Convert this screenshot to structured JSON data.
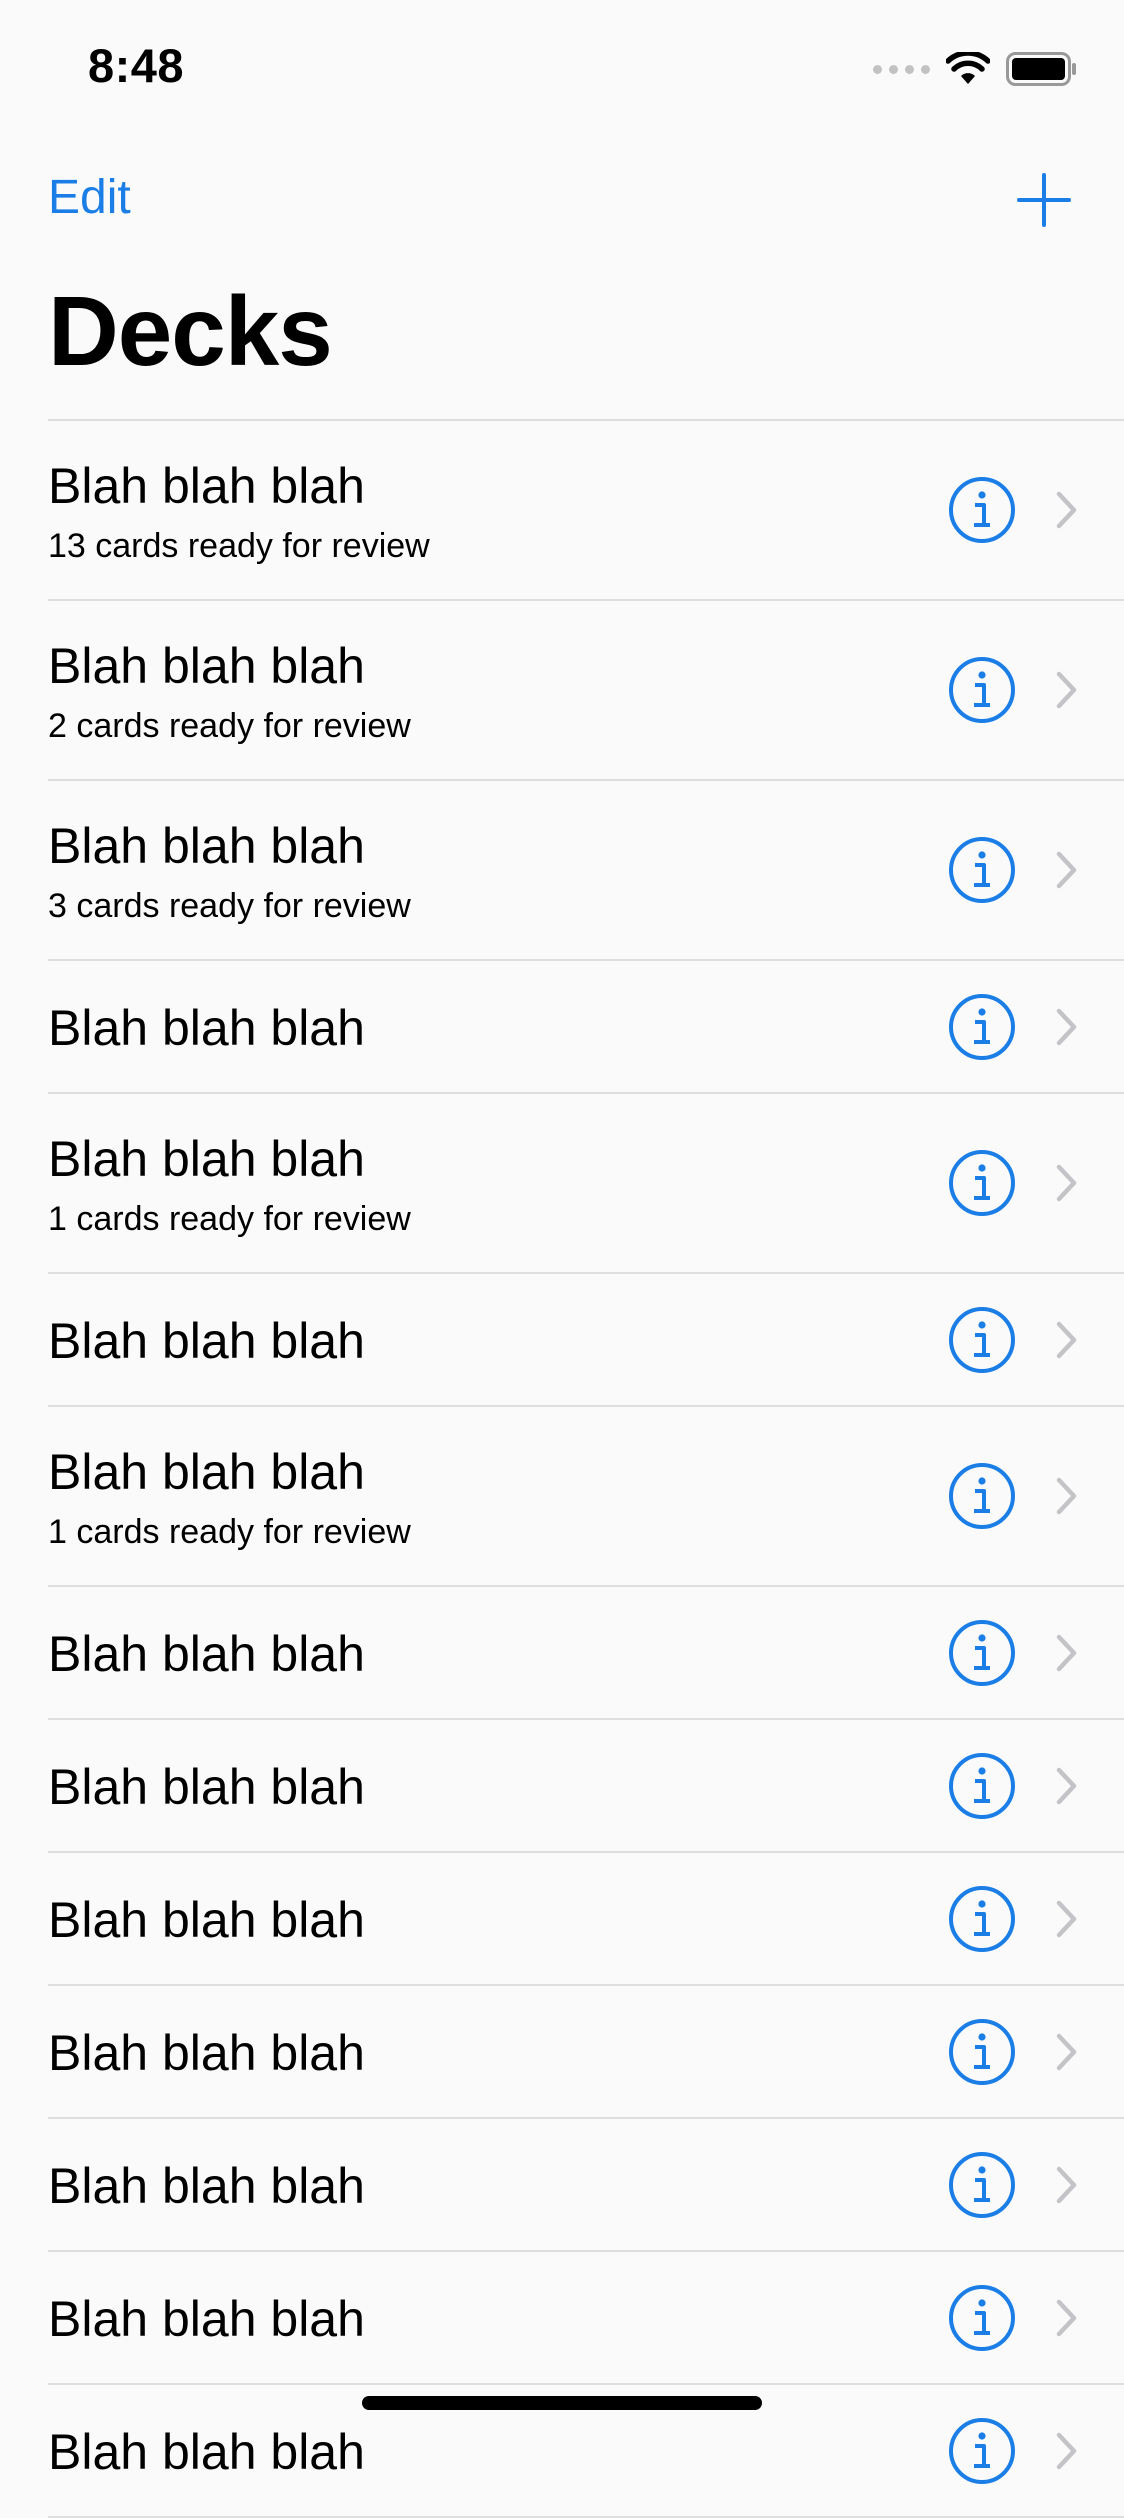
{
  "status_bar": {
    "time": "8:48"
  },
  "nav": {
    "edit_label": "Edit",
    "add_icon": "plus-icon"
  },
  "title": "Decks",
  "colors": {
    "accent": "#1a7ee6",
    "separator": "#dedede",
    "chevron": "#c4c4c8",
    "background": "#fafafa"
  },
  "decks": [
    {
      "title": "Blah blah blah",
      "subtitle": "13 cards ready for review"
    },
    {
      "title": "Blah blah blah",
      "subtitle": "2 cards ready for review"
    },
    {
      "title": "Blah blah blah",
      "subtitle": "3 cards ready for review"
    },
    {
      "title": "Blah blah blah",
      "subtitle": ""
    },
    {
      "title": "Blah blah blah",
      "subtitle": "1 cards ready for review"
    },
    {
      "title": "Blah blah blah",
      "subtitle": ""
    },
    {
      "title": "Blah blah blah",
      "subtitle": "1 cards ready for review"
    },
    {
      "title": "Blah blah blah",
      "subtitle": ""
    },
    {
      "title": "Blah blah blah",
      "subtitle": ""
    },
    {
      "title": "Blah blah blah",
      "subtitle": ""
    },
    {
      "title": "Blah blah blah",
      "subtitle": ""
    },
    {
      "title": "Blah blah blah",
      "subtitle": ""
    },
    {
      "title": "Blah blah blah",
      "subtitle": ""
    },
    {
      "title": "Blah blah blah",
      "subtitle": ""
    }
  ]
}
